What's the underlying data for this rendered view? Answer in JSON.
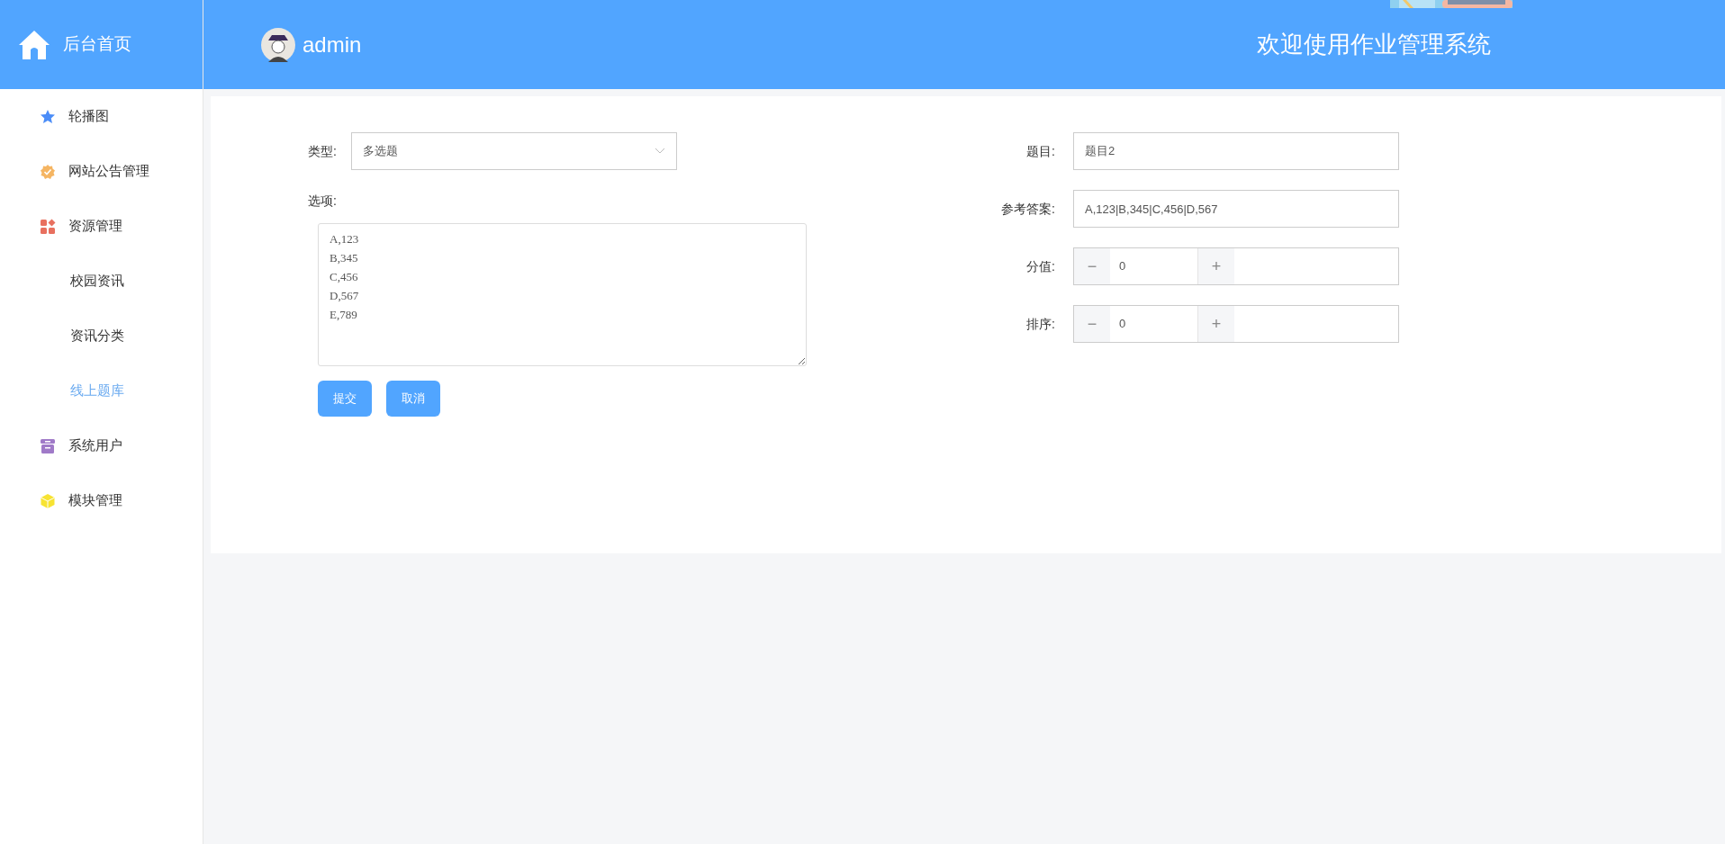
{
  "sidebar": {
    "brand": "后台首页",
    "items": [
      {
        "label": "轮播图",
        "selected": false
      },
      {
        "label": "网站公告管理",
        "selected": false
      },
      {
        "label": "资源管理",
        "selected": false,
        "children": [
          {
            "label": "校园资讯",
            "selected": false
          },
          {
            "label": "资讯分类",
            "selected": false
          },
          {
            "label": "线上题库",
            "selected": true
          }
        ]
      },
      {
        "label": "系统用户",
        "selected": false
      },
      {
        "label": "模块管理",
        "selected": false
      }
    ]
  },
  "header": {
    "user": "admin",
    "title": "欢迎使用作业管理系统"
  },
  "form": {
    "left": [
      {
        "kind": "select",
        "label": "类型:",
        "value": "多选题"
      },
      {
        "kind": "textarea",
        "label": "选项:",
        "value": "A,123\nB,345\nC,456\nD,567\nE,789"
      }
    ],
    "right": [
      {
        "kind": "text",
        "label": "题目:",
        "value": "题目2"
      },
      {
        "kind": "text",
        "label": "参考答案:",
        "value": "A,123|B,345|C,456|D,567"
      },
      {
        "kind": "stepper",
        "label": "分值:",
        "value": "0",
        "minus": "−",
        "plus": "+"
      },
      {
        "kind": "stepper",
        "label": "排序:",
        "value": "0",
        "minus": "−",
        "plus": "+"
      }
    ],
    "buttons": [
      "提交",
      "取消"
    ]
  }
}
